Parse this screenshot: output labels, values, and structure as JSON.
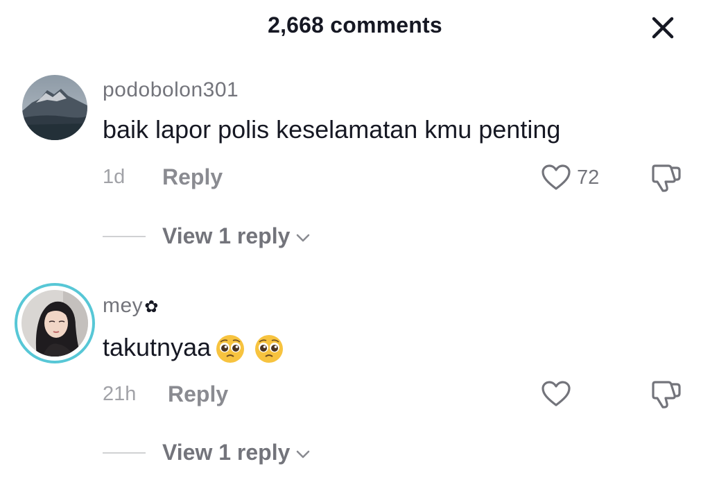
{
  "header": {
    "title": "2,668 comments",
    "close_icon": "close-icon"
  },
  "comments": [
    {
      "username": "podobolon301",
      "text": "baik lapor polis keselamatan kmu penting",
      "time": "1d",
      "reply_label": "Reply",
      "likes": "72",
      "view_replies": "View 1 reply"
    },
    {
      "username": "mey",
      "username_symbol": "✿",
      "text": "takutnyaa",
      "emojis": [
        "pleading-face-emoji",
        "pleading-face-emoji"
      ],
      "time": "21h",
      "reply_label": "Reply",
      "view_replies": "View 1 reply"
    }
  ],
  "colors": {
    "text": "#161823",
    "secondary": "#73747b",
    "muted": "#a1a2a7",
    "story_ring": "#57c7d6"
  }
}
